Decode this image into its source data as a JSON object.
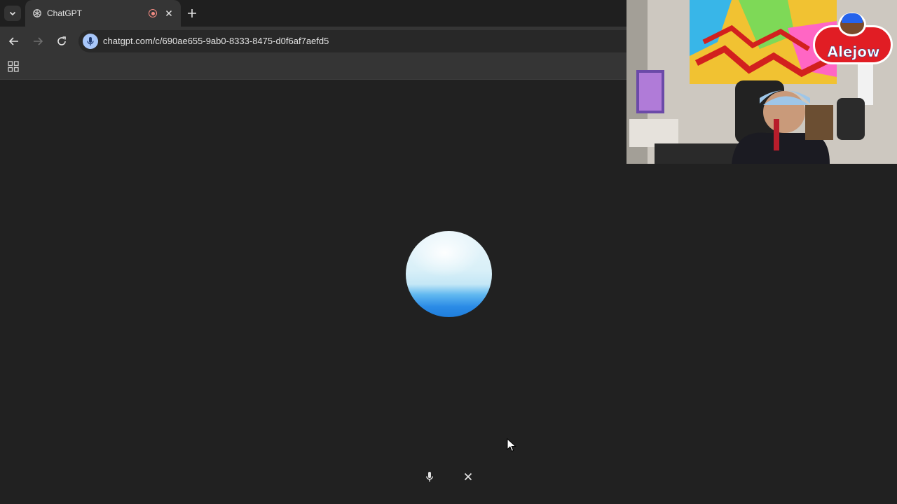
{
  "browser": {
    "tab": {
      "title": "ChatGPT",
      "favicon": "openai-logo-icon",
      "recording": true
    },
    "toolbar": {
      "url": "chatgpt.com/c/690ae655-9ab0-8333-8475-d0f6af7aefd5",
      "omnibox_icon": "microphone-icon"
    },
    "bookmarks_bar": {
      "apps_icon": "apps-grid-icon"
    }
  },
  "voice_mode": {
    "orb": "voice-orb",
    "controls": [
      {
        "icon": "microphone-icon"
      },
      {
        "icon": "close-icon"
      }
    ]
  },
  "webcam_overlay": {
    "streamer_logo_text": "Alejow"
  },
  "colors": {
    "background": "#212121",
    "toolbar": "#353535",
    "mic_pill": "#a8c7fa",
    "orb_blue": "#2b8be6",
    "logo_red": "#e11d24",
    "logo_blue": "#2563eb"
  }
}
